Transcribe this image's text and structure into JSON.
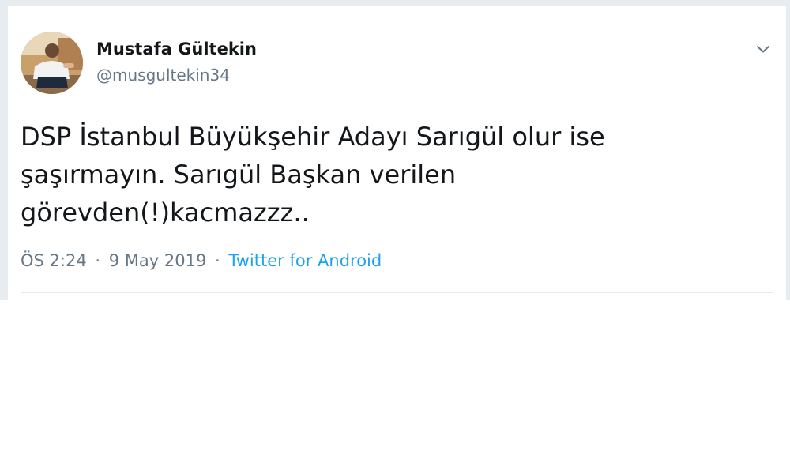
{
  "tweet": {
    "author": {
      "name": "Mustafa Gültekin",
      "handle": "@musgultekin34"
    },
    "text": "DSP İstanbul Büyükşehir Adayı Sarıgül olur ise\nşaşırmayın. Sarıgül Başkan verilen\ngörevden(!)kacmazzz..",
    "time": "ÖS 2:24",
    "date": "9 May 2019",
    "separator": "·",
    "source": "Twitter for Android"
  },
  "icons": {
    "menu": "chevron-down-icon"
  },
  "colors": {
    "text": "#14171a",
    "secondary": "#657786",
    "link": "#1da1f2",
    "background": "#e6ecf0"
  }
}
